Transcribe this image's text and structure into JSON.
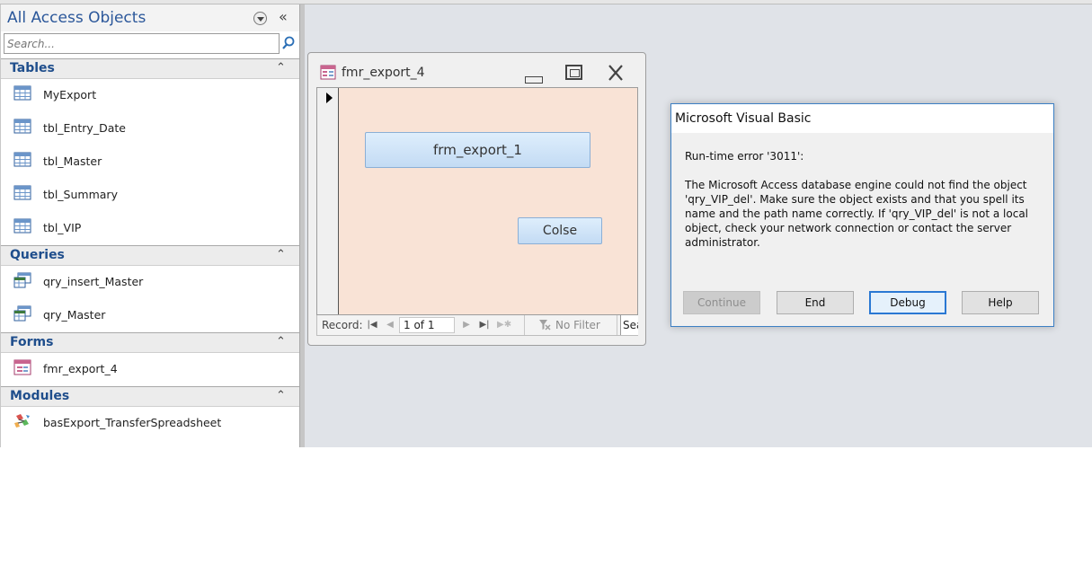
{
  "nav_pane": {
    "title": "All Access Objects",
    "search_placeholder": "Search...",
    "groups": [
      {
        "label": "Tables",
        "items": [
          "MyExport",
          "tbl_Entry_Date",
          "tbl_Master",
          "tbl_Summary",
          "tbl_VIP"
        ]
      },
      {
        "label": "Queries",
        "items": [
          "qry_insert_Master",
          "qry_Master"
        ]
      },
      {
        "label": "Forms",
        "items": [
          "fmr_export_4"
        ]
      },
      {
        "label": "Modules",
        "items": [
          "basExport_TransferSpreadsheet"
        ]
      }
    ]
  },
  "form_window": {
    "title": "fmr_export_4",
    "export_button_label": "frm_export_1",
    "colse_button_label": "Colse",
    "record_nav": {
      "label": "Record:",
      "current": "1 of 1",
      "filter_label": "No Filter",
      "search_text": "Search"
    }
  },
  "vb_dialog": {
    "title": "Microsoft Visual Basic",
    "error_code": "Run-time error '3011':",
    "message": "The Microsoft Access database engine could not find the object 'qry_VIP_del'. Make sure the object exists and that you spell its name and the path name correctly. If 'qry_VIP_del' is not a local object, check your network connection or contact the server administrator.",
    "buttons": {
      "continue": "Continue",
      "end": "End",
      "debug": "Debug",
      "help": "Help"
    }
  },
  "icons": {
    "table": "table-icon",
    "query": "query-icon",
    "form": "form-icon",
    "module": "module-icon"
  },
  "colors": {
    "accent_blue": "#2b579a",
    "group_label": "#1f4e8c",
    "form_background": "#f9e3d6",
    "dialog_border": "#3c7fc4"
  }
}
